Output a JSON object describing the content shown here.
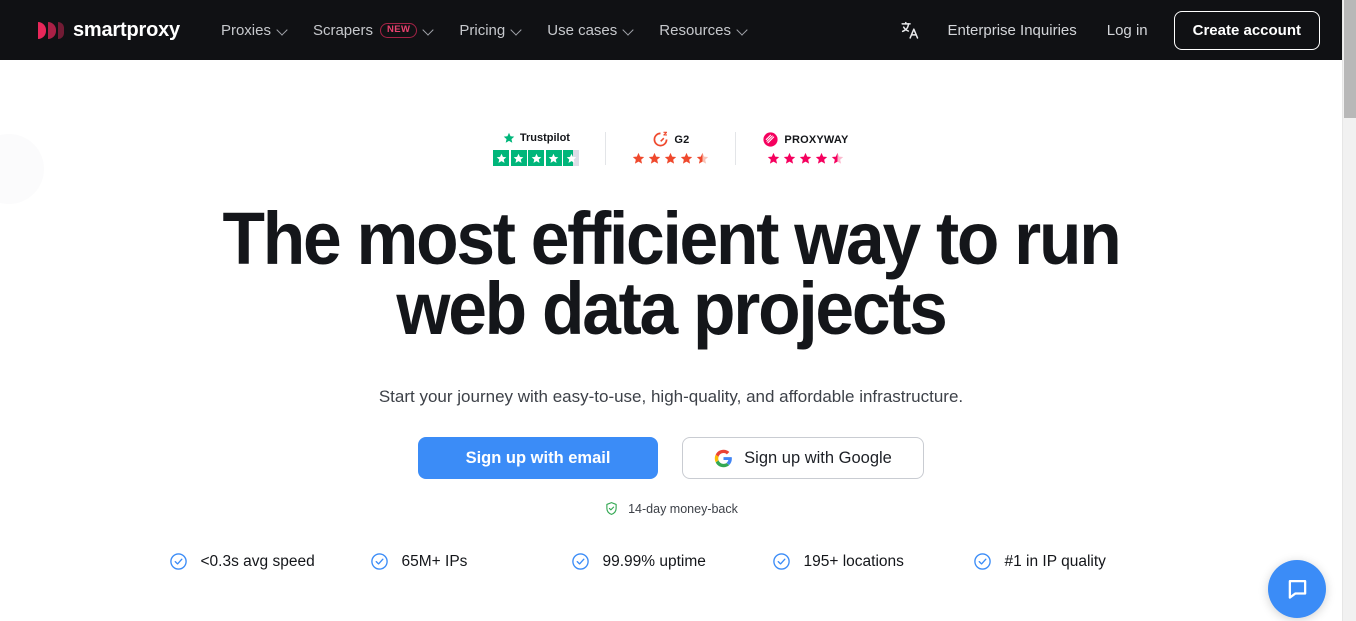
{
  "navbar": {
    "brand": "smartproxy",
    "brand_color": "#e8275a",
    "background": "#101114",
    "links": [
      {
        "label": "Proxies",
        "badge": null
      },
      {
        "label": "Scrapers",
        "badge": "NEW"
      },
      {
        "label": "Pricing",
        "badge": null
      },
      {
        "label": "Use cases",
        "badge": null
      },
      {
        "label": "Resources",
        "badge": null
      }
    ],
    "language_icon": "translate-icon",
    "enterprise_label": "Enterprise Inquiries",
    "login_label": "Log in",
    "create_account_label": "Create account"
  },
  "ratings": [
    {
      "name": "Trustpilot",
      "type": "trustpilot",
      "color": "#00b67a",
      "stars": 4.6,
      "filled": 4,
      "partial": 0.62
    },
    {
      "name": "G2",
      "type": "g2",
      "color": "#ef492d",
      "stars": 4.5,
      "filled": 4,
      "partial": 0.5
    },
    {
      "name": "PROXYWAY",
      "type": "proxyway",
      "color": "#f5005e",
      "stars": 4.5,
      "filled": 4,
      "partial": 0.5
    }
  ],
  "hero": {
    "title_line1": "The most efficient way to run",
    "title_line2": "web data projects",
    "subtitle": "Start your journey with easy-to-use, high-quality, and affordable infrastructure.",
    "cta_primary": "Sign up with email",
    "cta_primary_color": "#3b8cf7",
    "cta_secondary": "Sign up with Google",
    "cta_secondary_icon": "google-icon",
    "guarantee": "14-day money-back",
    "guarantee_icon": "shield-check-icon",
    "guarantee_color": "#34a853"
  },
  "features": [
    {
      "label": "<0.3s avg speed",
      "icon": "check-circle-icon"
    },
    {
      "label": "65M+ IPs",
      "icon": "check-circle-icon"
    },
    {
      "label": "99.99% uptime",
      "icon": "check-circle-icon"
    },
    {
      "label": "195+ locations",
      "icon": "check-circle-icon"
    },
    {
      "label": "#1 in IP quality",
      "icon": "check-circle-icon"
    }
  ],
  "chat_widget": {
    "icon": "chat-bubble-icon",
    "color": "#3b8cf7"
  },
  "scrollbar": {
    "thumb_color": "#b8b8b8",
    "track_color": "#f1f1f1"
  }
}
